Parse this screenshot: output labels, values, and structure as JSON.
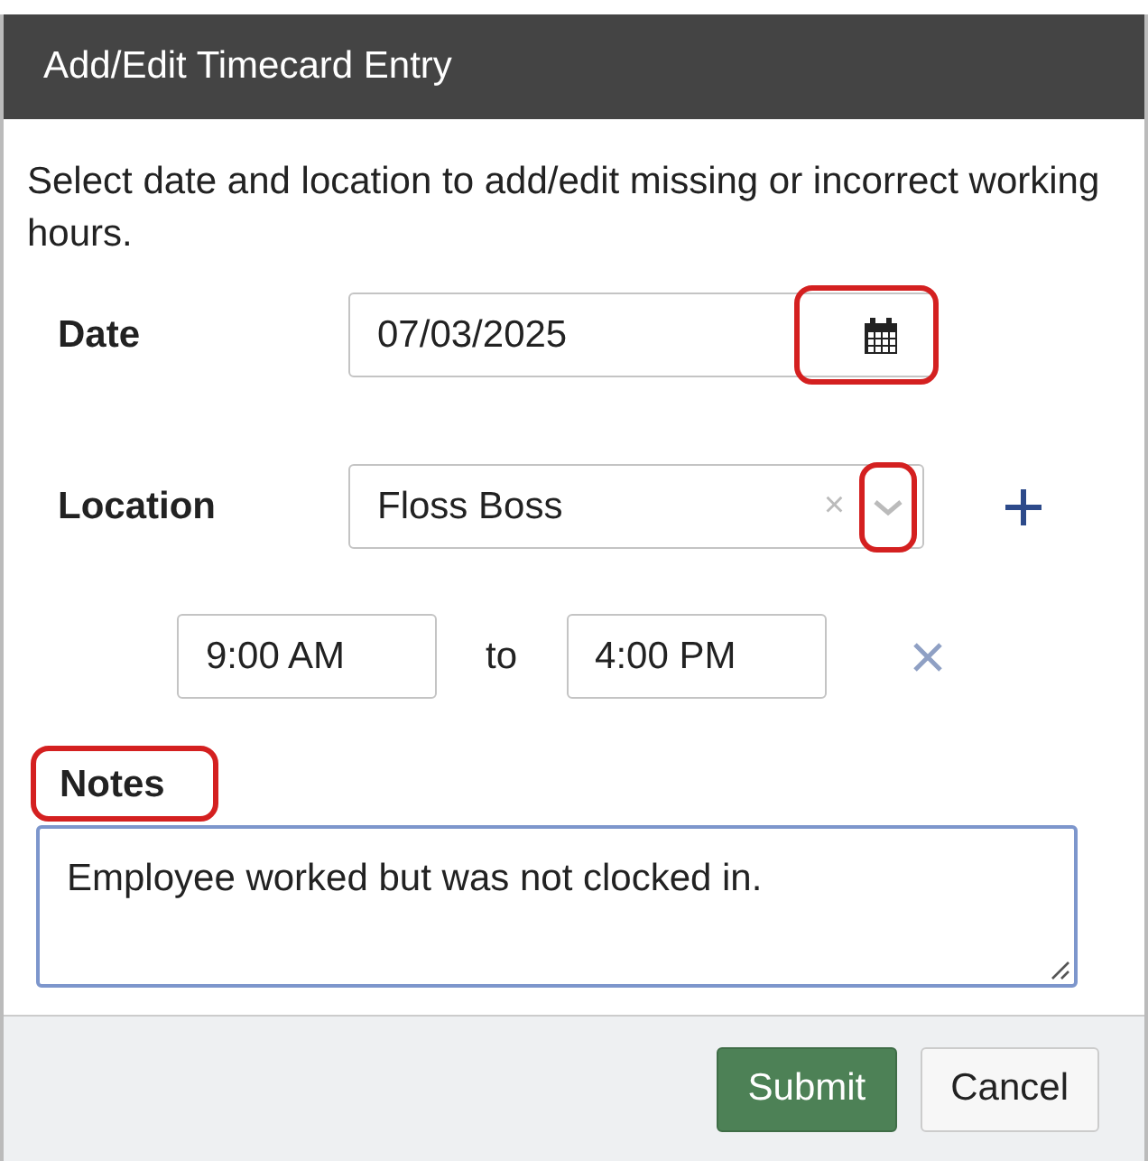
{
  "window": {
    "title": "Add/Edit Timecard Entry"
  },
  "intro": "Select date and location to add/edit missing or incorrect working hours.",
  "date": {
    "label": "Date",
    "value": "07/03/2025",
    "picker_highlighted": true
  },
  "location": {
    "label": "Location",
    "value": "Floss Boss",
    "clear": "×",
    "caret_highlighted": true
  },
  "hours": {
    "start": "9:00 AM",
    "separator": "to",
    "end": "4:00 PM"
  },
  "notes": {
    "label": "Notes",
    "label_highlighted": true,
    "value": "Employee worked but was not clocked in."
  },
  "buttons": [
    {
      "label": "Submit",
      "kind": "primary"
    },
    {
      "label": "Cancel",
      "kind": "secondary"
    }
  ]
}
